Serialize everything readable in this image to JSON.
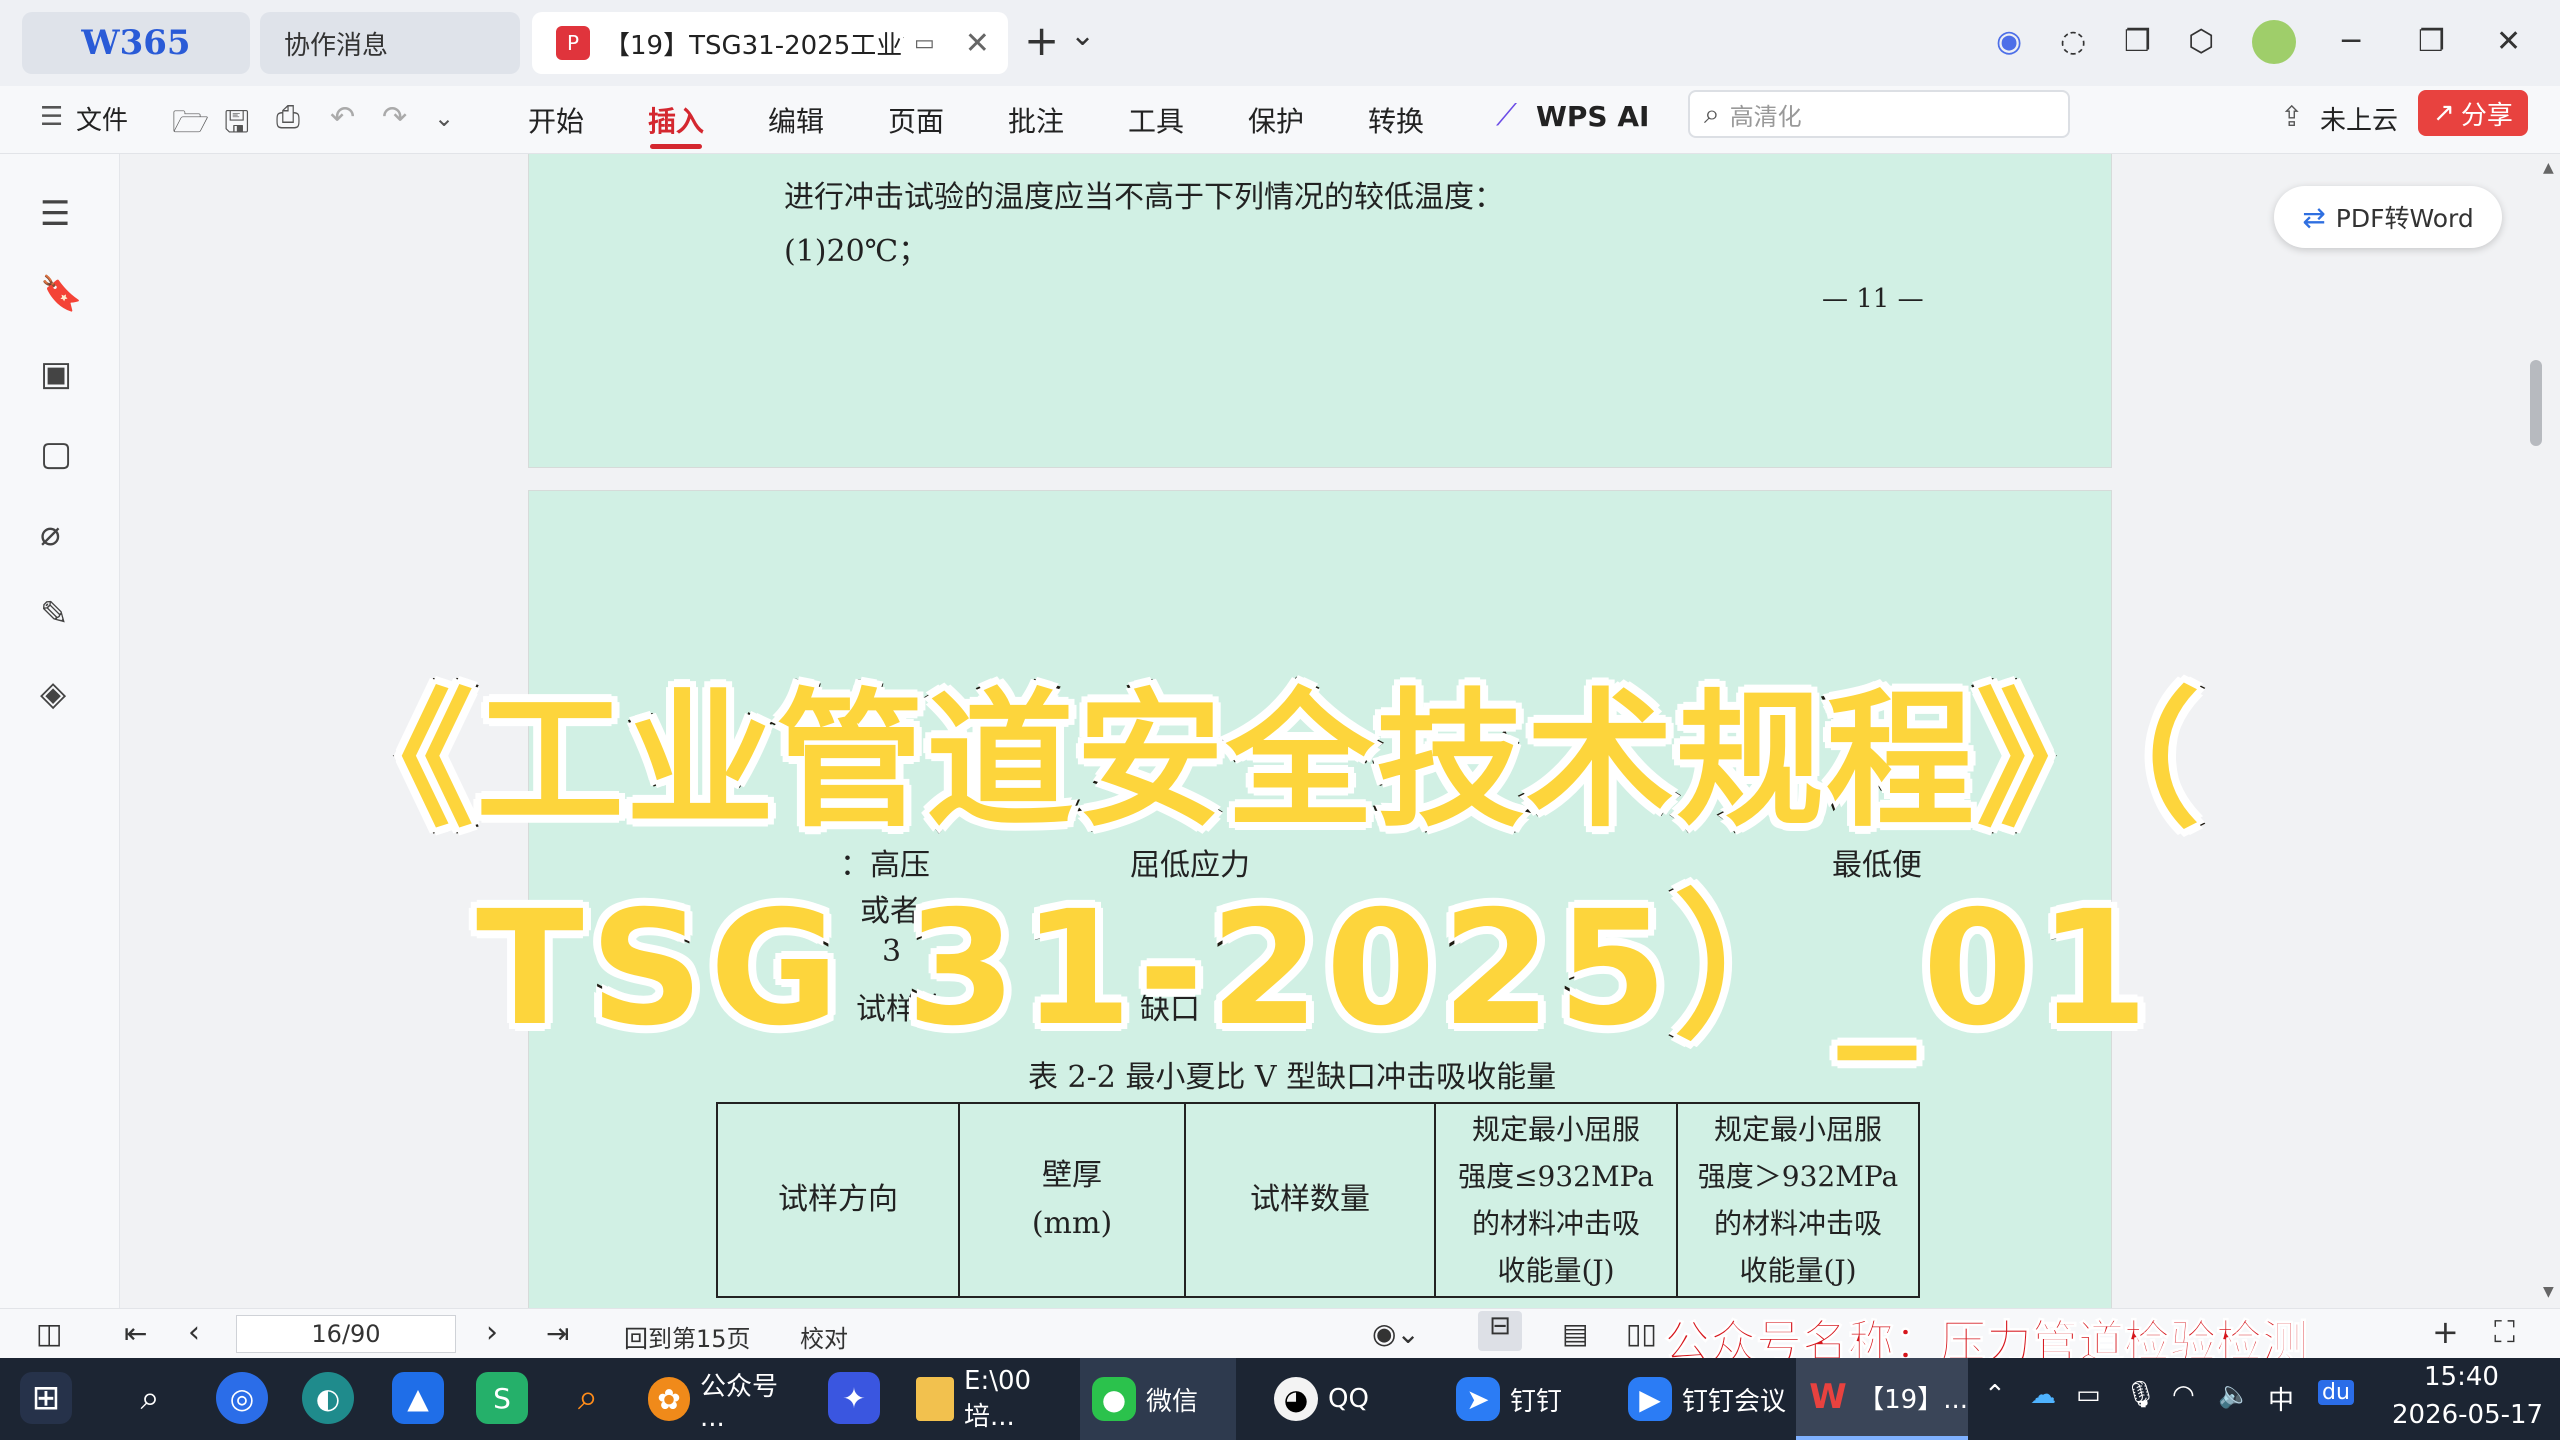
{
  "titlebar": {
    "app_tab": "W365",
    "collab_tab": "协作消息",
    "doc_tab": "【19】TSG31-2025工业管道",
    "add_tab": "+",
    "tab_dropdown": "⌄"
  },
  "toolbar": {
    "file_label": "文件",
    "menus": [
      "开始",
      "插入",
      "编辑",
      "页面",
      "批注",
      "工具",
      "保护",
      "转换"
    ],
    "wps_ai_label": "WPS AI",
    "search_placeholder": "高清化",
    "cloud_label": "未上云",
    "share_label": "分享"
  },
  "document": {
    "pdf_to_word_label": "PDF转Word",
    "page1": {
      "line1": "进行冲击试验的温度应当不高于下列情况的较低温度：",
      "line2": "(1)20℃；",
      "page_number": "— 11 —"
    },
    "page2": {
      "frag1": "：高压",
      "frag2": "屈低应力",
      "frag3": "最低便",
      "frag4": "或者",
      "frag5": "3",
      "frag6": "试样的",
      "frag7": "缺口",
      "table_caption": "表 2-2    最小夏比 V 型缺口冲击吸收能量",
      "table_headers": [
        "试样方向",
        "壁厚\n(mm)",
        "试样数量",
        "规定最小屈服\n强度≤932MPa\n的材料冲击吸\n收能量(J)",
        "规定最小屈服\n强度＞932MPa\n的材料冲击吸\n收能量(J)"
      ]
    }
  },
  "overlay": {
    "line1": "《工业管道安全技术规程》（",
    "line2": "TSG 31-2025）_01"
  },
  "statusbar": {
    "page_value": "16/90",
    "goto_label": "回到第15页",
    "proof_label": "校对"
  },
  "watermark": "公众号名称：压力管道检验检测",
  "taskbar": {
    "apps": [
      {
        "label": "公众号 ..."
      },
      {
        "label": "E:\\00培..."
      },
      {
        "label": "微信"
      },
      {
        "label": "QQ"
      },
      {
        "label": "钉钉"
      },
      {
        "label": "钉钉会议"
      },
      {
        "label": "【19】..."
      }
    ],
    "ime": "中",
    "time": "15:40",
    "date": "2026-05-17"
  },
  "colors": {
    "page_bg": "#d1f0e4",
    "accent_red": "#d4272f",
    "overlay_yellow": "#fdd53c",
    "taskbar": "#1c2533"
  }
}
